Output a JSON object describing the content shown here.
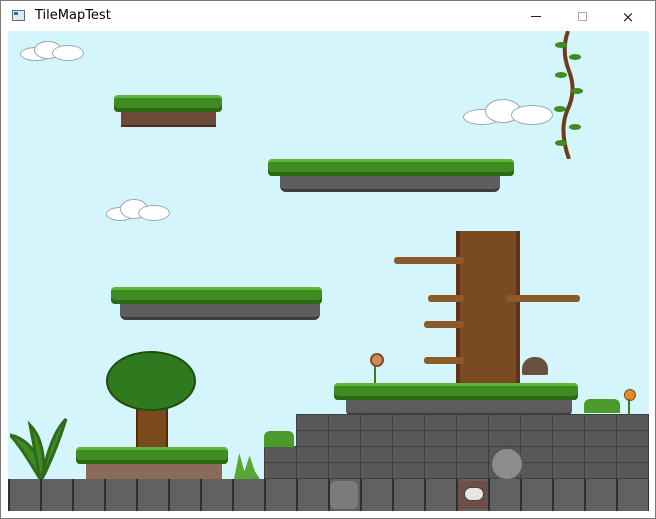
{
  "window": {
    "title": "TileMapTest",
    "icon": "app-window-icon"
  },
  "controls": {
    "minimize": "minimize-icon",
    "maximize": "maximize-icon",
    "close": "×"
  },
  "scene": {
    "sky_color": "#d4f5fb",
    "grass_color": "#3f8b22",
    "stone_color": "#585858"
  }
}
